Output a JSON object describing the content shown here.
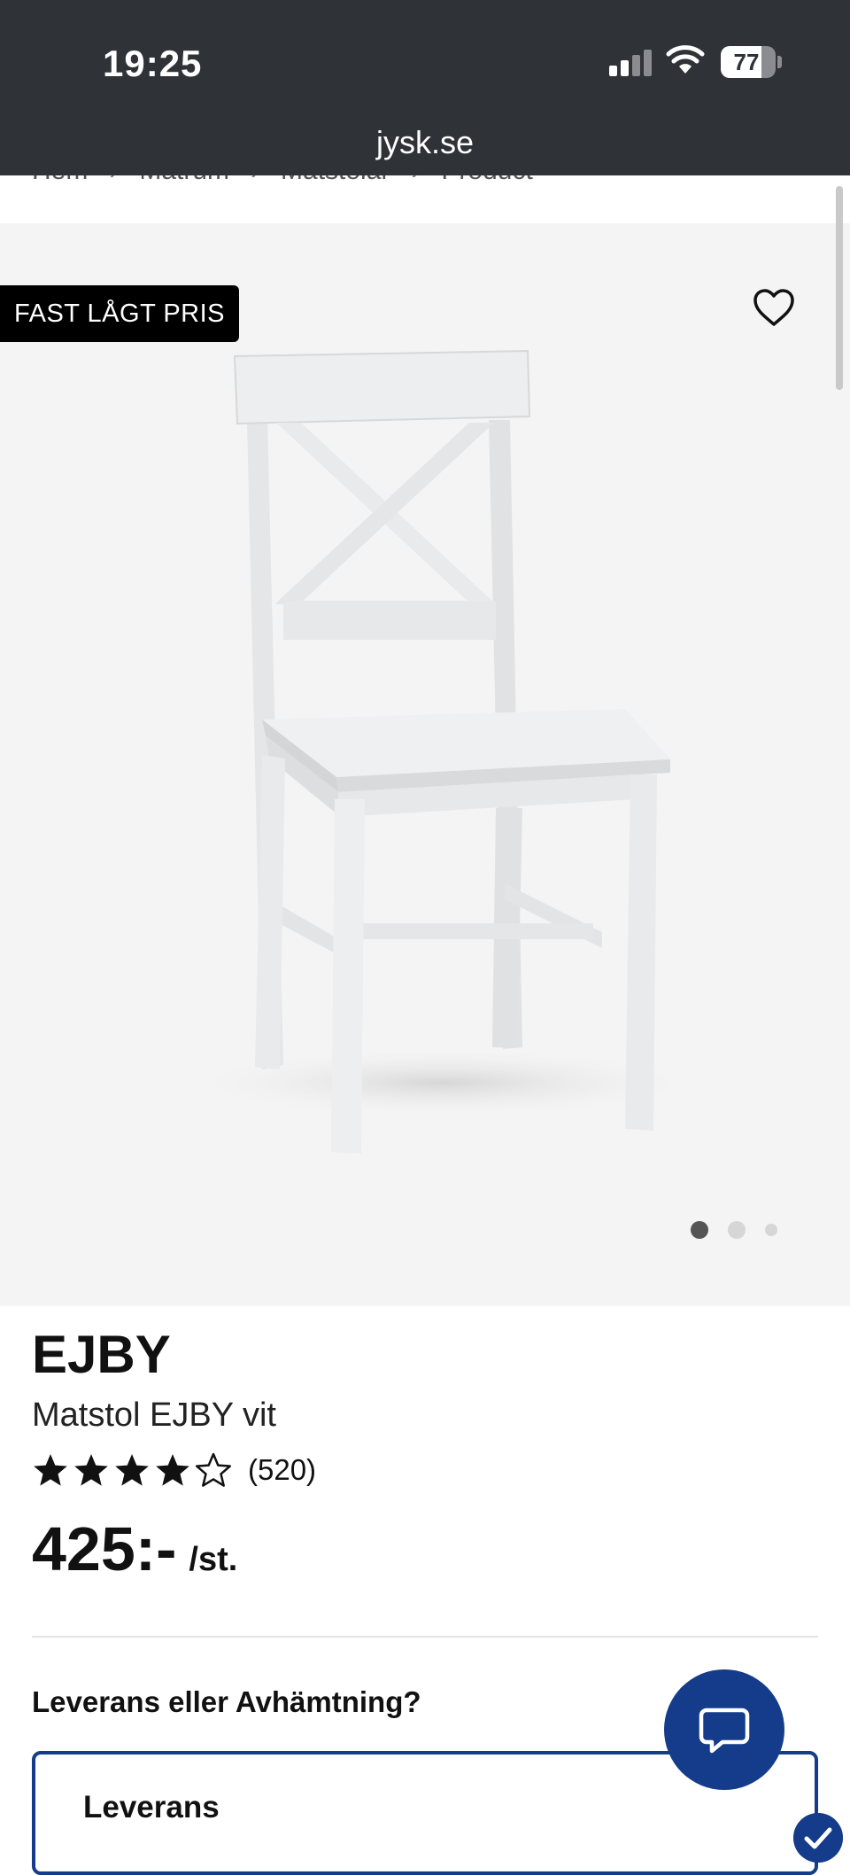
{
  "status_bar": {
    "time": "19:25",
    "battery": "77"
  },
  "browser": {
    "url": "jysk.se"
  },
  "breadcrumb": [
    "Hem",
    "Matrum",
    "Matstolar",
    "Product"
  ],
  "gallery": {
    "badge": "FAST LÅGT PRIS",
    "slides": 3,
    "active_slide": 1
  },
  "product": {
    "brand": "EJBY",
    "name": "Matstol EJBY vit",
    "rating": 4,
    "rating_max": 5,
    "review_count": "(520)",
    "price": "425:-",
    "price_unit": "/st."
  },
  "delivery": {
    "question": "Leverans eller Avhämtning?",
    "option_label": "Leverans"
  },
  "colors": {
    "topbar": "#2f3236",
    "accent": "#143c8a",
    "gallery_bg": "#f4f4f4"
  },
  "icons": {
    "favorite": "heart-icon",
    "chat": "chat-bubble-icon",
    "selected": "check-icon"
  }
}
